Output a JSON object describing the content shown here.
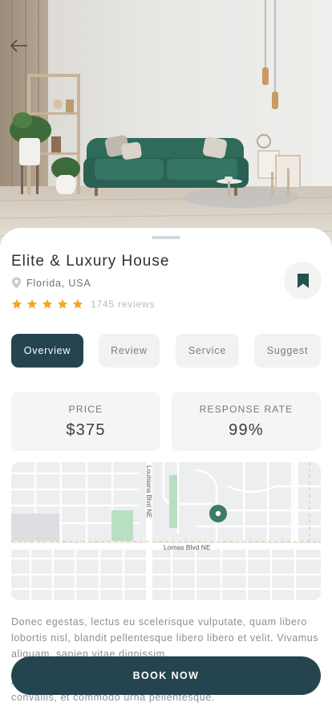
{
  "property": {
    "title": "Elite & Luxury House",
    "location": "Florida, USA",
    "rating_stars": 5,
    "reviews_text": "1745 reviews",
    "bookmarked": true
  },
  "tabs": [
    {
      "label": "Overview",
      "active": true
    },
    {
      "label": "Review",
      "active": false
    },
    {
      "label": "Service",
      "active": false
    },
    {
      "label": "Suggest",
      "active": false
    }
  ],
  "stats": {
    "price": {
      "label": "PRICE",
      "value": "$375"
    },
    "response": {
      "label": "RESPONSE RATE",
      "value": "99%"
    }
  },
  "map": {
    "street_vertical": "Loulsiana Blvd NE",
    "street_horizontal": "Lomas Blvd NE"
  },
  "description": {
    "paragraph1": "Donec egestas, lectus eu scelerisque vulputate, quam libero lobortis nisl, blandit pellentesque libero libero et velit. Vivamus aliquam, sapien vitae dignissim.",
    "paragraph2": "Aenean tempus at arcu non tempor. Sed mollis quam ut dolor convallis, et commodo urna pellentesque."
  },
  "cta": {
    "book_label": "BOOK NOW"
  },
  "colors": {
    "primary": "#244550",
    "star": "#f5a623",
    "bookmark": "#24524a",
    "map_pin": "#3d7a68",
    "map_park": "#b9dfc3"
  },
  "icons": [
    "arrow-left-icon",
    "location-pin-icon",
    "star-icon",
    "bookmark-icon",
    "map-pin-icon"
  ]
}
